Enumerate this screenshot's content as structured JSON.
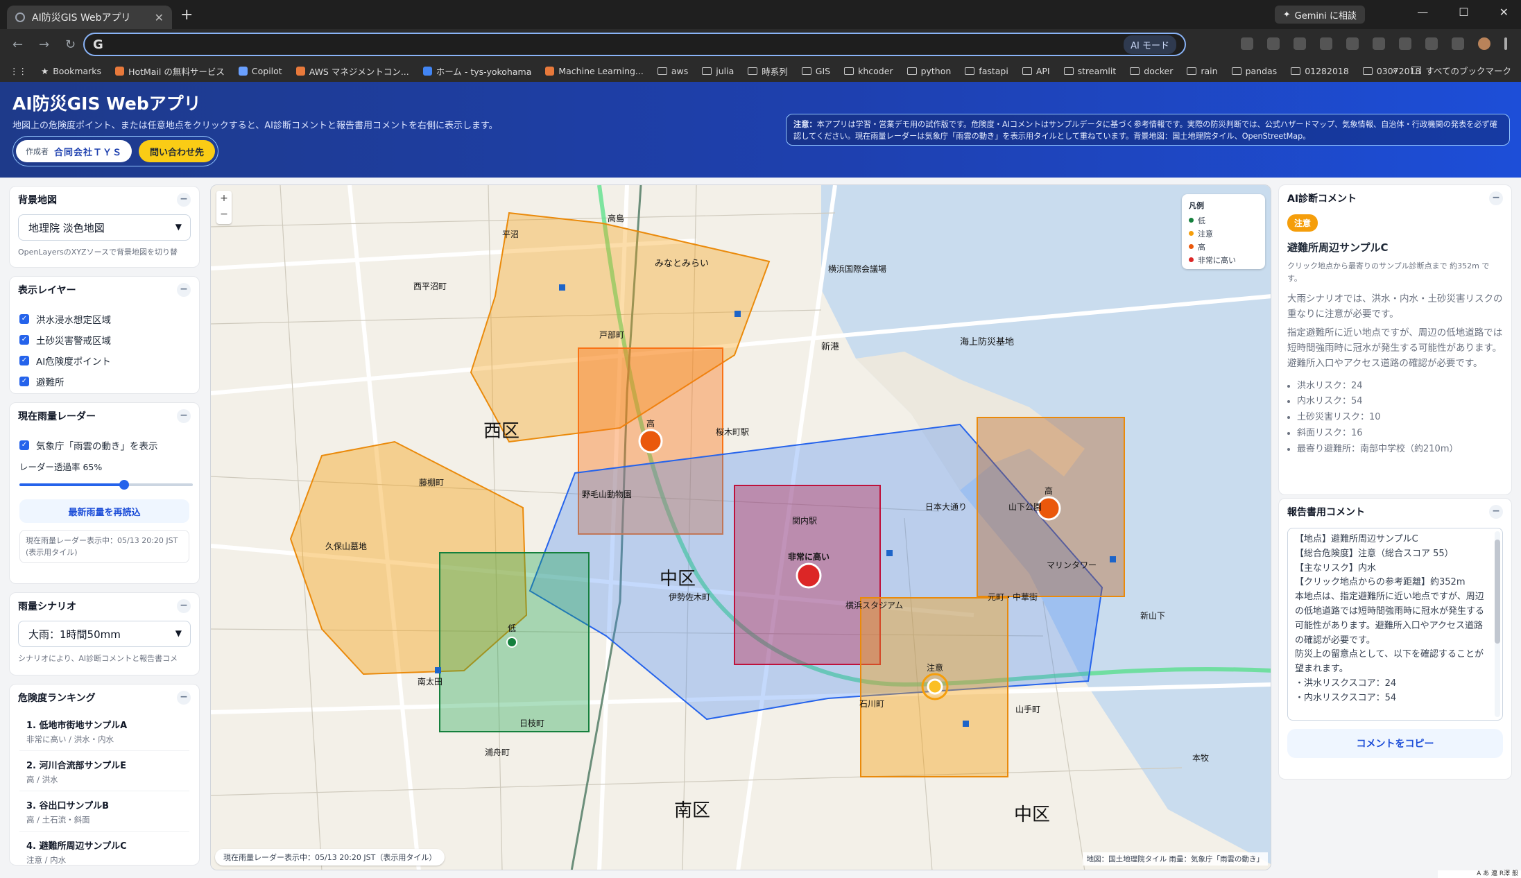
{
  "browser": {
    "tab_title": "AI防災GIS Webアプリ",
    "gemini": "Gemini に相談",
    "address": "",
    "ai_mode": "AI モード",
    "bookmarks": [
      "Bookmarks",
      "HotMail の無料サービス",
      "Copilot",
      "AWS マネジメントコン...",
      "ホーム - tys-yokohama",
      "Machine Learning...",
      "aws",
      "julia",
      "時系列",
      "GIS",
      "khcoder",
      "python",
      "fastapi",
      "API",
      "streamlit",
      "docker",
      "rain",
      "pandas",
      "01282018",
      "03072018"
    ],
    "all_bookmarks": "すべてのブックマーク"
  },
  "header": {
    "title": "AI防災GIS Webアプリ",
    "subtitle": "地図上の危険度ポイント、または任意地点をクリックすると、AI診断コメントと報告書用コメントを右側に表示します。",
    "author_label": "作成者",
    "author": "合同会社ＴＹＳ",
    "contact": "問い合わせ先",
    "notice_bold": "注意：",
    "notice": "本アプリは学習・営業デモ用の試作版です。危険度・AIコメントはサンプルデータに基づく参考情報です。実際の防災判断では、公式ハザードマップ、気象情報、自治体・行政機関の発表を必ず確認してください。現在雨量レーダーは気象庁「雨雲の動き」を表示用タイルとして重ねています。背景地図：国土地理院タイル、OpenStreetMap。"
  },
  "left": {
    "basemap": {
      "title": "背景地図",
      "selected": "地理院 淡色地図",
      "note": "OpenLayersのXYZソースで背景地図を切り替"
    },
    "layers": {
      "title": "表示レイヤー",
      "items": [
        "洪水浸水想定区域",
        "土砂災害警戒区域",
        "AI危険度ポイント",
        "避難所"
      ]
    },
    "radar": {
      "title": "現在雨量レーダー",
      "toggle": "気象庁「雨雲の動き」を表示",
      "opacity_label": "レーダー透過率 65%",
      "opacity": 0.65,
      "reload": "最新雨量を再読込",
      "status1": "現在雨量レーダー表示中：05/13 20:20 JST",
      "status2": "(表示用タイル)"
    },
    "scenario": {
      "title": "雨量シナリオ",
      "selected": "大雨：1時間50mm",
      "note": "シナリオにより、AI診断コメントと報告書コメ"
    },
    "ranking": {
      "title": "危険度ランキング",
      "items": [
        {
          "name": "1. 低地市街地サンプルA",
          "detail": "非常に高い / 洪水・内水"
        },
        {
          "name": "2. 河川合流部サンプルE",
          "detail": "高 / 洪水"
        },
        {
          "name": "3. 谷出口サンプルB",
          "detail": "高 / 土石流・斜面"
        },
        {
          "name": "4. 避難所周辺サンプルC",
          "detail": "注意 / 内水"
        }
      ]
    }
  },
  "map": {
    "legend": {
      "title": "凡例",
      "items": [
        {
          "label": "低",
          "color": "#15803d"
        },
        {
          "label": "注意",
          "color": "#f59e0b"
        },
        {
          "label": "高",
          "color": "#ea580c"
        },
        {
          "label": "非常に高い",
          "color": "#dc2626"
        }
      ]
    },
    "points": {
      "high1": "高",
      "high2": "高",
      "very_high": "非常に高い",
      "low": "低",
      "caution": "注意"
    },
    "districts": {
      "nishi": "西区",
      "naka1": "中区",
      "minami": "南区",
      "naka2": "中区"
    },
    "places": [
      "みなとみらい",
      "横浜国際会議場",
      "新港",
      "海上防災基地",
      "野毛山動物園",
      "横浜スタジアム",
      "山下公園",
      "マリンタワー",
      "伊勢佐木町",
      "日本大通り",
      "関内駅",
      "桜木町駅",
      "元町・中華街",
      "石川町",
      "山手町",
      "西平沼町",
      "南太田",
      "日枝町",
      "高島",
      "戸部町",
      "平沼",
      "藤棚町",
      "久保山墓地",
      "新山下",
      "本牧",
      "浦舟町"
    ],
    "footer": "現在雨量レーダー表示中：05/13 20:20 JST（表示用タイル）",
    "attribution": "地図：国土地理院タイル 雨量：気象庁「雨雲の動き」"
  },
  "right": {
    "ai": {
      "title": "AI診断コメント",
      "badge": "注意",
      "place": "避難所周辺サンプルC",
      "meta": "クリック地点から最寄りのサンプル診断点まで 約352m です。",
      "para1": "大雨シナリオでは、洪水・内水・土砂災害リスクの重なりに注意が必要です。",
      "para2": "指定避難所に近い地点ですが、周辺の低地道路では短時間強雨時に冠水が発生する可能性があります。避難所入口やアクセス道路の確認が必要です。",
      "risks": [
        "洪水リスク：24",
        "内水リスク：54",
        "土砂災害リスク：10",
        "斜面リスク：16",
        "最寄り避難所：南部中学校（約210m）"
      ]
    },
    "report": {
      "title": "報告書用コメント",
      "lines": [
        "【地点】避難所周辺サンプルC",
        "【総合危険度】注意（総合スコア 55）",
        "【主なリスク】内水",
        "【クリック地点からの参考距離】約352m",
        "本地点は、指定避難所に近い地点ですが、周辺の低地道路では短時間強雨時に冠水が発生する可能性があります。避難所入口やアクセス道路の確認が必要です。",
        "防災上の留意点として、以下を確認することが望まれます。",
        "・洪水リスクスコア：24",
        "・内水リスクスコア：54"
      ],
      "copy": "コメントをコピー"
    }
  },
  "ime": "A あ 連 R澤 般"
}
